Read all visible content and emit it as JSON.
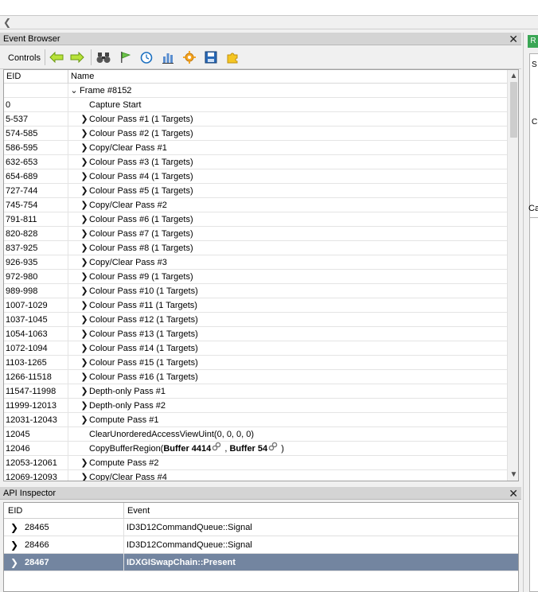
{
  "event_browser": {
    "title": "Event Browser",
    "controls_label": "Controls",
    "columns": {
      "eid": "EID",
      "name": "Name"
    },
    "toolbar_icons": [
      "back-arrow-icon",
      "forward-arrow-icon",
      "find-binoculars-icon",
      "bookmark-flag-icon",
      "timer-icon",
      "column-chart-icon",
      "settings-gear-icon",
      "save-icon",
      "export-puzzle-icon"
    ],
    "frame_label": "Frame #8152",
    "rows": [
      {
        "eid": "0",
        "name": "Capture Start",
        "expandable": false
      },
      {
        "eid": "5-537",
        "name": "Colour Pass #1 (1 Targets)",
        "expandable": true
      },
      {
        "eid": "574-585",
        "name": "Colour Pass #2 (1 Targets)",
        "expandable": true
      },
      {
        "eid": "586-595",
        "name": "Copy/Clear Pass #1",
        "expandable": true
      },
      {
        "eid": "632-653",
        "name": "Colour Pass #3 (1 Targets)",
        "expandable": true
      },
      {
        "eid": "654-689",
        "name": "Colour Pass #4 (1 Targets)",
        "expandable": true
      },
      {
        "eid": "727-744",
        "name": "Colour Pass #5 (1 Targets)",
        "expandable": true
      },
      {
        "eid": "745-754",
        "name": "Copy/Clear Pass #2",
        "expandable": true
      },
      {
        "eid": "791-811",
        "name": "Colour Pass #6 (1 Targets)",
        "expandable": true
      },
      {
        "eid": "820-828",
        "name": "Colour Pass #7 (1 Targets)",
        "expandable": true
      },
      {
        "eid": "837-925",
        "name": "Colour Pass #8 (1 Targets)",
        "expandable": true
      },
      {
        "eid": "926-935",
        "name": "Copy/Clear Pass #3",
        "expandable": true
      },
      {
        "eid": "972-980",
        "name": "Colour Pass #9 (1 Targets)",
        "expandable": true
      },
      {
        "eid": "989-998",
        "name": "Colour Pass #10 (1 Targets)",
        "expandable": true
      },
      {
        "eid": "1007-1029",
        "name": "Colour Pass #11 (1 Targets)",
        "expandable": true
      },
      {
        "eid": "1037-1045",
        "name": "Colour Pass #12 (1 Targets)",
        "expandable": true
      },
      {
        "eid": "1054-1063",
        "name": "Colour Pass #13 (1 Targets)",
        "expandable": true
      },
      {
        "eid": "1072-1094",
        "name": "Colour Pass #14 (1 Targets)",
        "expandable": true
      },
      {
        "eid": "1103-1265",
        "name": "Colour Pass #15 (1 Targets)",
        "expandable": true
      },
      {
        "eid": "1266-11518",
        "name": "Colour Pass #16 (1 Targets)",
        "expandable": true
      },
      {
        "eid": "11547-11998",
        "name": "Depth-only Pass #1",
        "expandable": true
      },
      {
        "eid": "11999-12013",
        "name": "Depth-only Pass #2",
        "expandable": true
      },
      {
        "eid": "12031-12043",
        "name": "Compute Pass #1",
        "expandable": true
      },
      {
        "eid": "12045",
        "name": "ClearUnorderedAccessViewUint(0, 0, 0, 0)",
        "expandable": false
      },
      {
        "eid": "12069-12093",
        "name": "Copy/Clear Pass #4",
        "expandable": true
      }
    ],
    "copy_row": {
      "eid": "12046",
      "func": "CopyBufferRegion(",
      "arg1": "Buffer 4414",
      "comma": " , ",
      "arg2": "Buffer 54",
      "close": " )"
    },
    "compute2_row": {
      "eid": "12053-12061",
      "name": "Compute Pass #2"
    }
  },
  "api_inspector": {
    "title": "API Inspector",
    "columns": {
      "eid": "EID",
      "event": "Event"
    },
    "rows": [
      {
        "eid": "28465",
        "event": "ID3D12CommandQueue::Signal",
        "selected": false
      },
      {
        "eid": "28466",
        "event": "ID3D12CommandQueue::Signal",
        "selected": false
      },
      {
        "eid": "28467",
        "event": "IDXGISwapChain::Present",
        "selected": true
      }
    ]
  },
  "right_panel": {
    "tab_label": "R",
    "box_text_1": "S",
    "box_text_2": "C",
    "label": "Ca"
  },
  "colors": {
    "selection": "#7385a0",
    "title_bar": "#d4d4d4",
    "accent_green": "#3aa655"
  }
}
